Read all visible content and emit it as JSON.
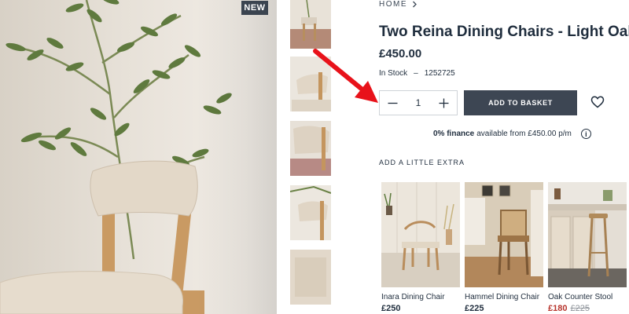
{
  "badge": "NEW",
  "breadcrumb": {
    "home": "HOME"
  },
  "product": {
    "title": "Two Reina Dining Chairs - Light Oak",
    "price": "£450.00",
    "stock_status": "In Stock",
    "stock_separator": "–",
    "product_code": "1252725"
  },
  "purchase": {
    "quantity": "1",
    "add_to_basket": "ADD TO BASKET"
  },
  "finance": {
    "bold": "0% finance",
    "text": "available from £450.00 p/m",
    "info": "i"
  },
  "extras": {
    "heading": "ADD A LITTLE EXTRA",
    "items": [
      {
        "name": "Inara Dining Chair",
        "price": "£250"
      },
      {
        "name": "Hammel Dining Chair",
        "price": "£225"
      },
      {
        "name": "Oak Counter Stool",
        "price": "£180",
        "was_price": "£225"
      }
    ]
  },
  "icons": {
    "minus": "minus-icon",
    "plus": "plus-icon",
    "heart": "heart-icon",
    "info": "info-icon",
    "chevron": "chevron-right-icon"
  },
  "colors": {
    "primary_button": "#3d4653",
    "text": "#1f2d3d",
    "sale": "#b7342c",
    "annotation_arrow": "#e8121a"
  }
}
